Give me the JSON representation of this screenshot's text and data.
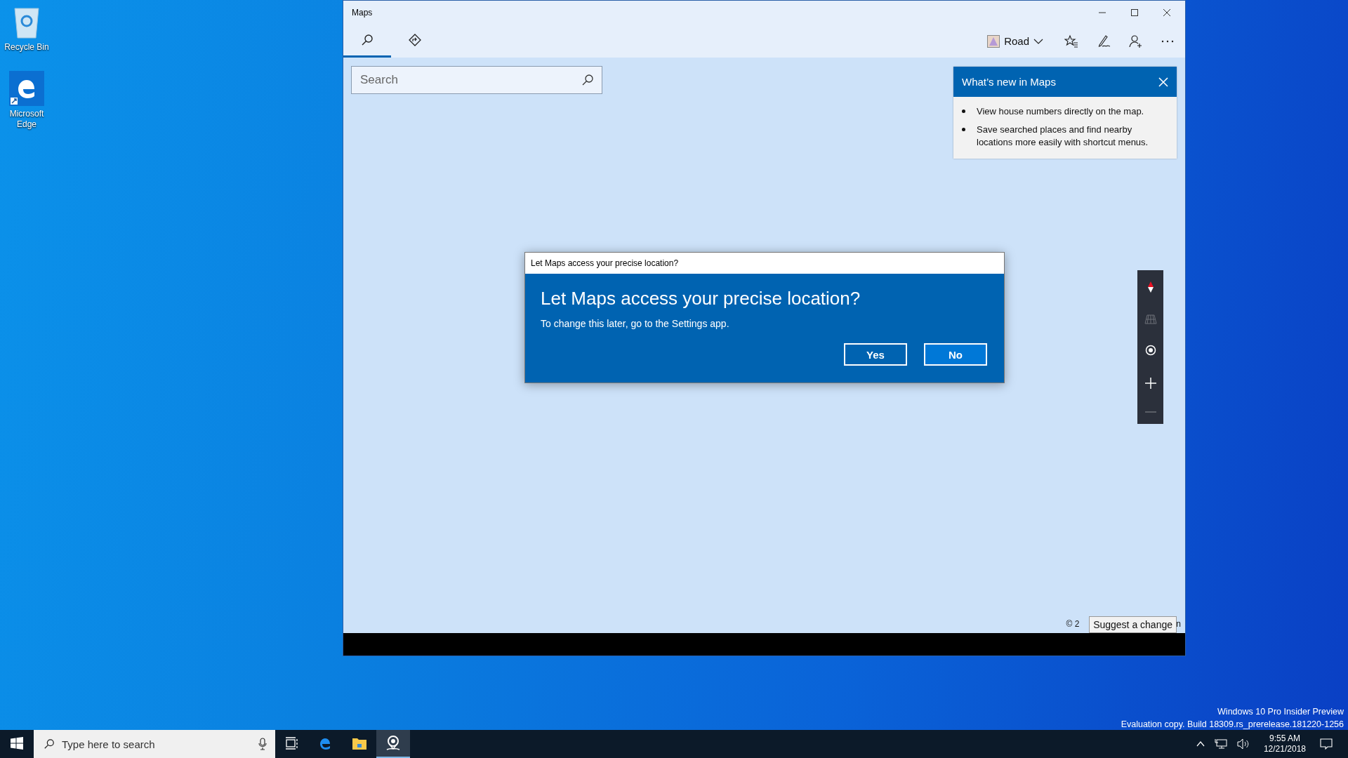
{
  "desktop_icons": [
    {
      "kind": "recycle",
      "label": "Recycle Bin"
    },
    {
      "kind": "edge",
      "label": "Microsoft Edge"
    }
  ],
  "window": {
    "title": "Maps",
    "tabs": [
      {
        "kind": "search",
        "selected": true
      },
      {
        "kind": "directions",
        "selected": false
      }
    ],
    "map_style": "Road",
    "search": {
      "placeholder": "Search"
    },
    "whats_new": {
      "title": "What’s new in Maps",
      "items": [
        "View house numbers directly on the map.",
        "Save searched places and find nearby locations more easily with shortcut menus."
      ]
    },
    "dialog": {
      "title_bar": "Let Maps access your precise location?",
      "heading": "Let Maps access your precise location?",
      "message": "To change this later, go to the Settings app.",
      "buttons": [
        {
          "label": "Yes",
          "selected": false
        },
        {
          "label": "No",
          "selected": true
        }
      ]
    },
    "map_controls": [
      {
        "kind": "compass",
        "disabled": false
      },
      {
        "kind": "tilt",
        "disabled": true
      },
      {
        "kind": "locate",
        "disabled": false
      },
      {
        "kind": "zoom_in",
        "disabled": false
      },
      {
        "kind": "zoom_out",
        "disabled": true
      }
    ],
    "attribution": {
      "start": "© 2",
      "end": "n"
    },
    "tooltip": "Suggest a change"
  },
  "desktop_watermark": [
    "Windows 10 Pro Insider Preview",
    "Evaluation copy. Build 18309.rs_prerelease.181220-1256"
  ],
  "taskbar": {
    "search_placeholder": "Type here to search",
    "apps": [
      {
        "kind": "taskview",
        "selected": false
      },
      {
        "kind": "edge",
        "selected": false
      },
      {
        "kind": "explorer",
        "selected": false
      },
      {
        "kind": "maps",
        "selected": true
      }
    ],
    "time": "9:55 AM",
    "date": "12/21/2018"
  }
}
